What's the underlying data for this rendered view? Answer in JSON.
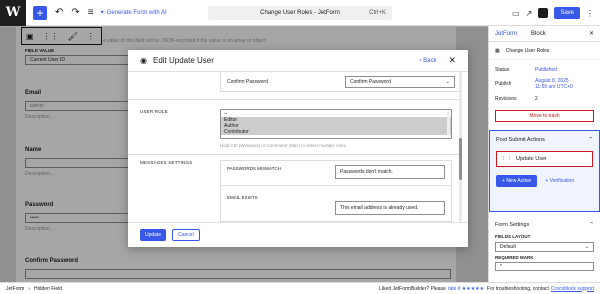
{
  "topbar": {
    "ai_label": "Generate Form with AI",
    "doc_title": "Change User Roles - JetForm",
    "shortcut": "Ctrl+K",
    "save_label": "Save"
  },
  "editor": {
    "help_top": "e value of this field will be JSON-encoded if the value is an array or object",
    "field_value_label": "FIELD VALUE",
    "field_value": "Current User ID",
    "fields": [
      {
        "label": "Email",
        "value": "admin",
        "desc": "Description..."
      },
      {
        "label": "Name",
        "value": "",
        "desc": "Description..."
      },
      {
        "label": "Password",
        "value": "•••••",
        "desc": "Description..."
      },
      {
        "label": "Confirm Password",
        "value": "",
        "desc": ""
      }
    ]
  },
  "sidebar": {
    "tabs": [
      "JetForm",
      "Block"
    ],
    "form_name": "Change User Roles",
    "status_label": "Status",
    "status_value": "Published",
    "publish_label": "Publish",
    "publish_value_1": "August 8, 2025",
    "publish_value_2": "11:55 am UTC+0",
    "revisions_label": "Revisions",
    "revisions_value": "2",
    "trash_label": "Move to trash",
    "post_submit_title": "Post Submit Actions",
    "action_item": "Update User",
    "new_action_label": "New Action",
    "verification_label": "Verification",
    "form_settings_title": "Form Settings",
    "fields_layout_label": "FIELDS LAYOUT",
    "fields_layout_value": "Default",
    "required_mark_label": "REQUIRED MARK",
    "required_mark_value": "*"
  },
  "footer": {
    "breadcrumb_1": "JetForm",
    "breadcrumb_2": "Hidden Field",
    "promo_text": "Liked JetFormBuilder? Please",
    "promo_link": "rate it ★★★★★",
    "promo_text_2": ". For troubleshooting, contact",
    "support_link": "Crocoblock support"
  },
  "modal": {
    "title": "Edit Update User",
    "back_label": "Back",
    "confirm_password_left": "Confirm Password",
    "confirm_password_select": "Confirm Password",
    "user_role_label": "USER ROLE",
    "role_options": [
      "--",
      "Editor",
      "Author",
      "Contributor"
    ],
    "role_help": "Hold Ctrl (Windows) or Command (Mac) to select multiple roles.",
    "messages_label": "MESSAGES SETTINGS",
    "password_mismatch_label": "PASSWORDS MISMATCH",
    "password_mismatch_value": "Passwords don't match.",
    "email_exists_label": "EMAIL EXISTS",
    "email_exists_value": "This email address is already used.",
    "update_label": "Update",
    "cancel_label": "Cancel"
  }
}
